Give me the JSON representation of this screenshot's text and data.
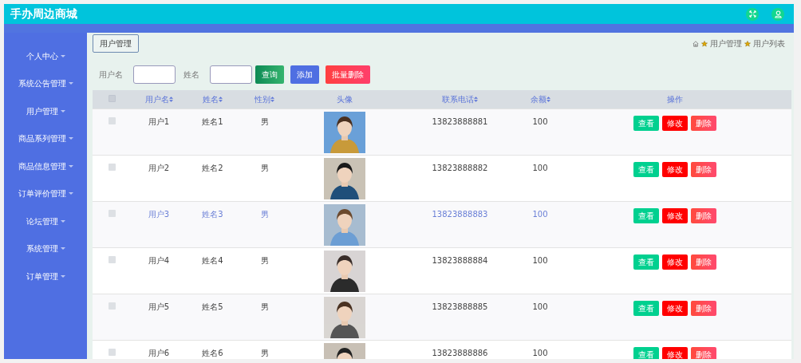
{
  "header": {
    "title": "手办周边商城"
  },
  "sidebar": {
    "items": [
      {
        "label": "个人中心"
      },
      {
        "label": "系统公告管理"
      },
      {
        "label": "用户管理"
      },
      {
        "label": "商品系列管理"
      },
      {
        "label": "商品信息管理"
      },
      {
        "label": "订单评价管理"
      },
      {
        "label": "论坛管理"
      },
      {
        "label": "系统管理"
      },
      {
        "label": "订单管理"
      }
    ]
  },
  "tab": {
    "label": "用户管理"
  },
  "breadcrumb": [
    "用户管理",
    "用户列表"
  ],
  "search": {
    "fields": [
      {
        "label": "用户名"
      },
      {
        "label": "姓名"
      }
    ],
    "buttons": [
      {
        "label": "查询",
        "kind": "search"
      },
      {
        "label": "添加",
        "kind": "add"
      },
      {
        "label": "批量删除",
        "kind": "delete"
      }
    ]
  },
  "table": {
    "all_checked": false,
    "columns": [
      {
        "label": "用户名",
        "sortable": true
      },
      {
        "label": "姓名",
        "sortable": true
      },
      {
        "label": "性别",
        "sortable": true
      },
      {
        "label": "头像",
        "sortable": false
      },
      {
        "label": "联系电话",
        "sortable": true
      },
      {
        "label": "余额",
        "sortable": true
      },
      {
        "label": "操作",
        "sortable": false
      }
    ],
    "rows": [
      {
        "username": "用户1",
        "name": "姓名1",
        "gender": "男",
        "phone": "13823888881",
        "balance": "100",
        "highlighted": false,
        "checked": false,
        "actions": [
          {
            "label": "查看",
            "kind": "view"
          },
          {
            "label": "修改",
            "kind": "edit"
          },
          {
            "label": "删除",
            "kind": "delete"
          }
        ]
      },
      {
        "username": "用户2",
        "name": "姓名2",
        "gender": "男",
        "phone": "13823888882",
        "balance": "100",
        "highlighted": false,
        "checked": false,
        "actions": [
          {
            "label": "查看",
            "kind": "view"
          },
          {
            "label": "修改",
            "kind": "edit"
          },
          {
            "label": "删除",
            "kind": "delete"
          }
        ]
      },
      {
        "username": "用户3",
        "name": "姓名3",
        "gender": "男",
        "phone": "13823888883",
        "balance": "100",
        "highlighted": true,
        "checked": false,
        "actions": [
          {
            "label": "查看",
            "kind": "view"
          },
          {
            "label": "修改",
            "kind": "edit"
          },
          {
            "label": "删除",
            "kind": "delete"
          }
        ]
      },
      {
        "username": "用户4",
        "name": "姓名4",
        "gender": "男",
        "phone": "13823888884",
        "balance": "100",
        "highlighted": false,
        "checked": false,
        "actions": [
          {
            "label": "查看",
            "kind": "view"
          },
          {
            "label": "修改",
            "kind": "edit"
          },
          {
            "label": "删除",
            "kind": "delete"
          }
        ]
      },
      {
        "username": "用户5",
        "name": "姓名5",
        "gender": "男",
        "phone": "13823888885",
        "balance": "100",
        "highlighted": false,
        "checked": false,
        "actions": [
          {
            "label": "查看",
            "kind": "view"
          },
          {
            "label": "修改",
            "kind": "edit"
          },
          {
            "label": "删除",
            "kind": "delete"
          }
        ]
      },
      {
        "username": "用户6",
        "name": "姓名6",
        "gender": "男",
        "phone": "13823888886",
        "balance": "100",
        "highlighted": false,
        "checked": false,
        "actions": [
          {
            "label": "查看",
            "kind": "view"
          },
          {
            "label": "修改",
            "kind": "edit"
          },
          {
            "label": "删除",
            "kind": "delete"
          }
        ]
      }
    ]
  }
}
